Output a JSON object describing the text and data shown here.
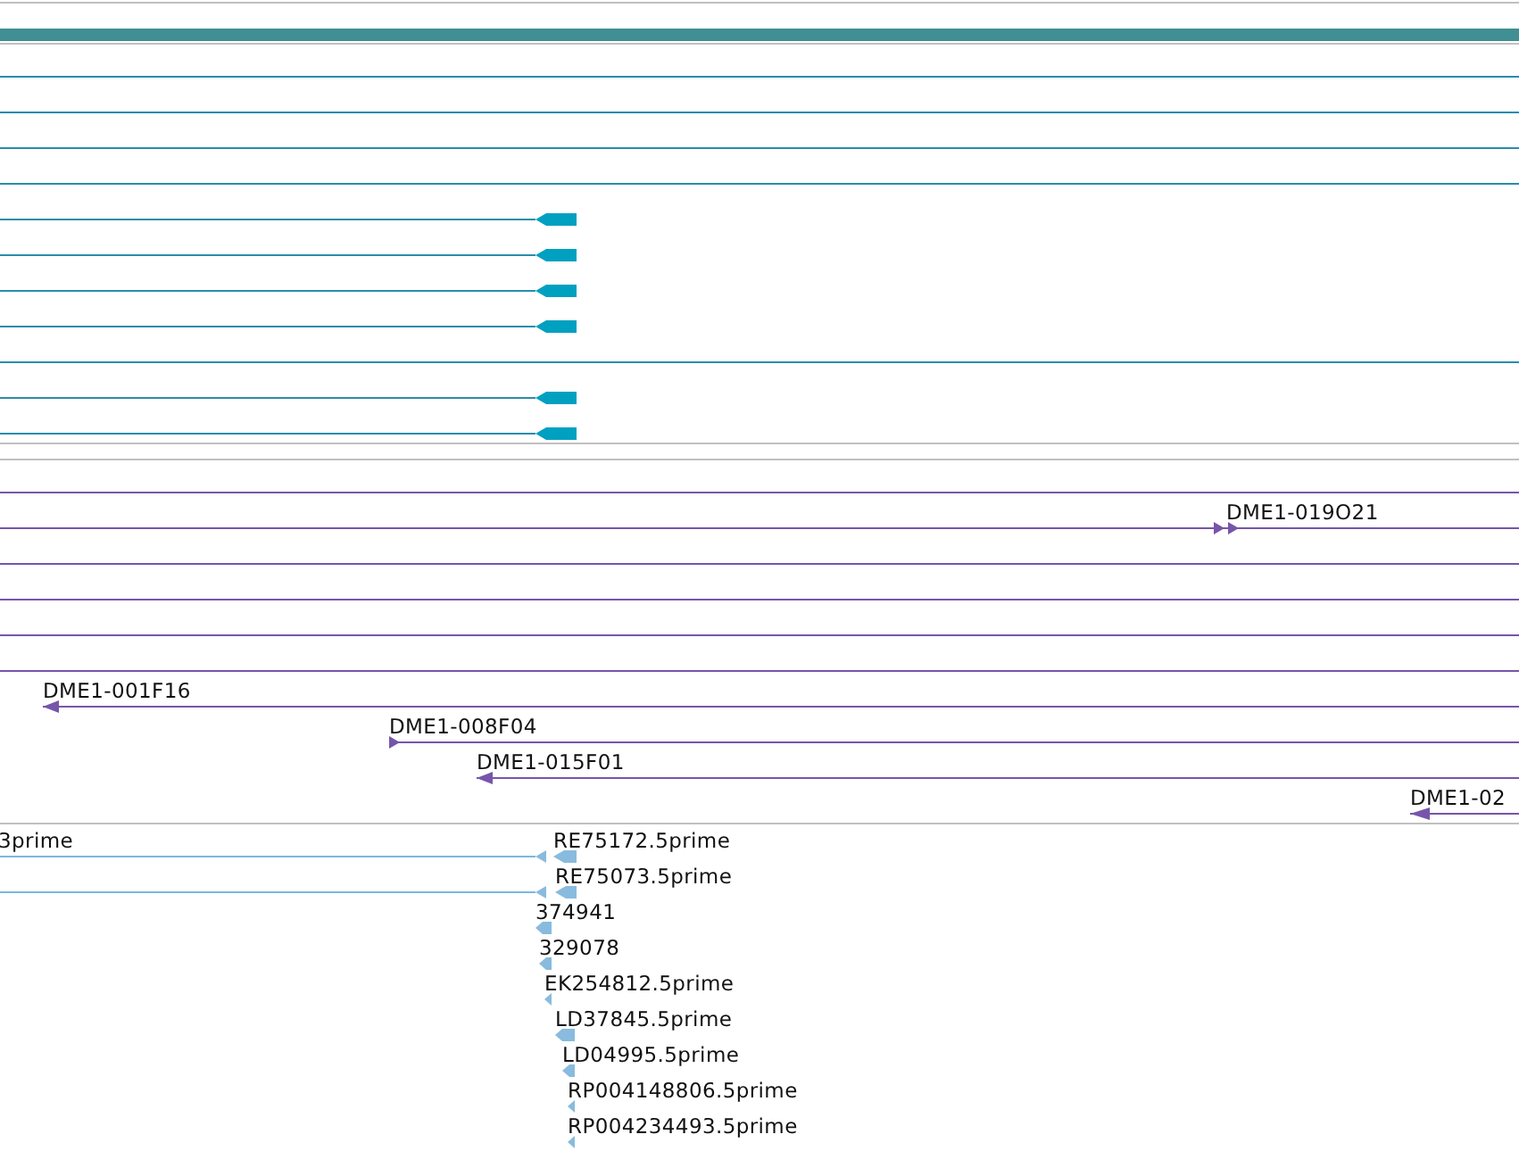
{
  "tracks": [
    {
      "kind": "gene",
      "rows": [
        {
          "features": [
            {
              "kind": "line"
            }
          ]
        },
        {
          "features": [
            {
              "kind": "line"
            }
          ]
        },
        {
          "features": [
            {
              "kind": "line"
            }
          ]
        },
        {
          "features": [
            {
              "kind": "line"
            }
          ]
        },
        {
          "features": [
            {
              "kind": "arrow",
              "reverse": true
            }
          ]
        },
        {
          "features": [
            {
              "kind": "arrow",
              "reverse": true
            }
          ]
        },
        {
          "features": [
            {
              "kind": "arrow",
              "reverse": true
            }
          ]
        },
        {
          "features": [
            {
              "kind": "arrow",
              "reverse": true
            }
          ]
        },
        {
          "features": [
            {
              "kind": "line"
            }
          ]
        },
        {
          "features": [
            {
              "kind": "arrow",
              "reverse": true
            }
          ]
        },
        {
          "features": [
            {
              "kind": "arrow",
              "reverse": true
            }
          ]
        }
      ]
    },
    {
      "kind": "clone",
      "rows": [
        {
          "features": [
            {
              "kind": "line"
            }
          ]
        },
        {
          "features": [
            {
              "kind": "arrow",
              "reverse": false,
              "label": "DME1-019O21"
            }
          ]
        },
        {
          "features": [
            {
              "kind": "line"
            }
          ]
        },
        {
          "features": [
            {
              "kind": "line"
            }
          ]
        },
        {
          "features": [
            {
              "kind": "line"
            }
          ]
        },
        {
          "features": [
            {
              "kind": "line"
            }
          ]
        },
        {
          "features": [
            {
              "kind": "arrow",
              "reverse": true,
              "label": "DME1-001F16"
            }
          ]
        },
        {
          "features": [
            {
              "kind": "arrow",
              "reverse": false,
              "label": "DME1-008F04"
            }
          ]
        },
        {
          "features": [
            {
              "kind": "arrow",
              "reverse": true,
              "label": "DME1-015F01"
            }
          ]
        },
        {
          "features": [
            {
              "kind": "arrow",
              "reverse": true,
              "label": "DME1-02"
            }
          ]
        }
      ]
    },
    {
      "kind": "est",
      "rows": [
        {
          "features": [
            {
              "kind": "arrow",
              "reverse": true,
              "label": "3prime"
            },
            {
              "kind": "arrow",
              "reverse": true,
              "label": "RE75172.5prime"
            }
          ]
        },
        {
          "features": [
            {
              "kind": "arrow",
              "reverse": true
            },
            {
              "kind": "arrow",
              "reverse": true,
              "label": "RE75073.5prime"
            }
          ]
        },
        {
          "features": [
            {
              "kind": "arrow",
              "reverse": true,
              "label": "374941"
            }
          ]
        },
        {
          "features": [
            {
              "kind": "arrow",
              "reverse": true,
              "label": "329078"
            }
          ]
        },
        {
          "features": [
            {
              "kind": "arrow",
              "reverse": true,
              "label": "EK254812.5prime"
            }
          ]
        },
        {
          "features": [
            {
              "kind": "arrow",
              "reverse": true,
              "label": "LD37845.5prime"
            }
          ]
        },
        {
          "features": [
            {
              "kind": "arrow",
              "reverse": true,
              "label": "LD04995.5prime"
            }
          ]
        },
        {
          "features": [
            {
              "kind": "arrow",
              "reverse": true,
              "label": "RP004148806.5prime"
            }
          ]
        },
        {
          "features": [
            {
              "kind": "arrow",
              "reverse": true,
              "label": "RP004234493.5prime"
            }
          ]
        }
      ]
    }
  ]
}
